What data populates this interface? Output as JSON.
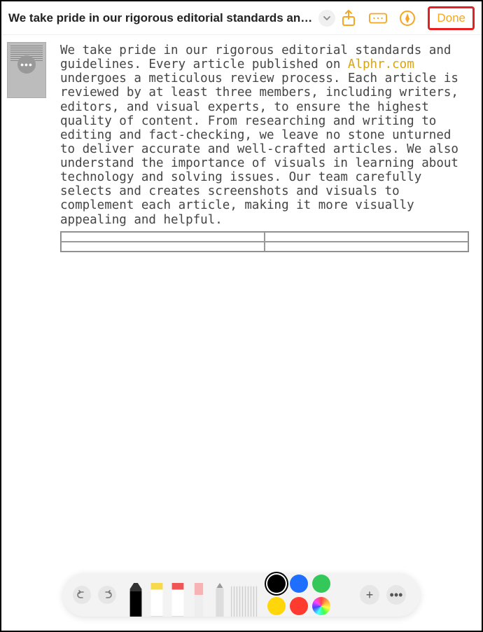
{
  "header": {
    "title": "We take pride in our rigorous editorial standards and gui...",
    "done_label": "Done"
  },
  "document": {
    "text_before_link": "We take pride in our rigorous editorial standards and guidelines. Every article published on ",
    "link_text": "Alphr.com",
    "text_after_link": " undergoes a meticulous review process. Each article is reviewed by at least three members, including writers, editors, and visual experts, to ensure the highest quality of content. From researching and writing to editing and fact-checking, we leave no stone unturned to deliver accurate and well-crafted articles. We also understand the importance of visuals in learning about technology and solving issues. Our team carefully selects and creates screenshots and visuals to complement each article, making it more visually appealing and helpful."
  },
  "toolbar": {
    "colors": [
      "#000000",
      "#1e6fff",
      "#34c759",
      "#ffd60a",
      "#ff3b30"
    ]
  }
}
